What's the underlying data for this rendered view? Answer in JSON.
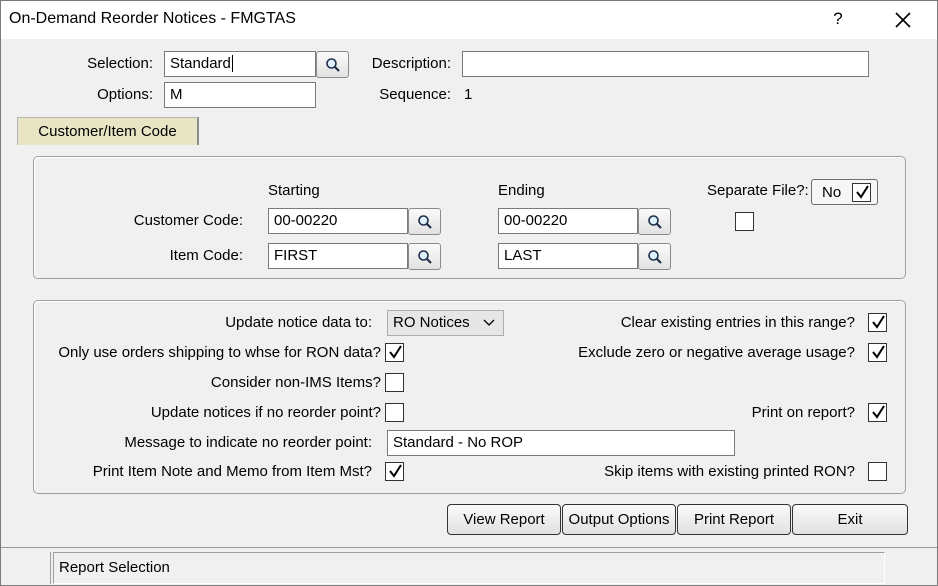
{
  "window": {
    "title": "On-Demand Reorder Notices - FMGTAS",
    "help": "?"
  },
  "header": {
    "selection_label": "Selection:",
    "selection_value": "Standard",
    "description_label": "Description:",
    "description_value": "",
    "options_label": "Options:",
    "options_value": "M",
    "sequence_label": "Sequence:",
    "sequence_value": "1"
  },
  "tabs": [
    {
      "label": "Customer/Item Code",
      "active": true
    }
  ],
  "range": {
    "starting_label": "Starting",
    "ending_label": "Ending",
    "separate_file_label": "Separate File?:",
    "separate_file_value": "No",
    "separate_file_checked": true,
    "customer_code_label": "Customer Code:",
    "customer_code_start": "00-00220",
    "customer_code_end": "00-00220",
    "customer_extra_checked": false,
    "item_code_label": "Item Code:",
    "item_code_start": "FIRST",
    "item_code_end": "LAST"
  },
  "options": {
    "update_notice_label": "Update notice data to:",
    "update_notice_value": "RO Notices",
    "only_use_orders_label": "Only use orders shipping to whse for RON data?",
    "only_use_orders_checked": true,
    "consider_non_ims_label": "Consider non-IMS Items?",
    "consider_non_ims_checked": false,
    "update_no_rop_label": "Update notices if no reorder point?",
    "update_no_rop_checked": false,
    "message_label": "Message to indicate no reorder point:",
    "message_value": "Standard - No ROP",
    "print_item_note_label": "Print Item Note and Memo from Item Mst?",
    "print_item_note_checked": true,
    "clear_existing_label": "Clear existing entries in this range?",
    "clear_existing_checked": true,
    "exclude_zero_label": "Exclude zero or negative average usage?",
    "exclude_zero_checked": true,
    "print_on_report_label": "Print on report?",
    "print_on_report_checked": true,
    "skip_items_label": "Skip items with existing printed RON?",
    "skip_items_checked": false
  },
  "buttons": {
    "view_report": "View Report",
    "output_options": "Output Options",
    "print_report": "Print Report",
    "exit": "Exit"
  },
  "status": {
    "text": "Report Selection"
  },
  "icons": {
    "lookup": "magnifier-icon",
    "check": "checkmark-icon",
    "close": "close-icon",
    "dropdown": "chevron-down-icon"
  }
}
